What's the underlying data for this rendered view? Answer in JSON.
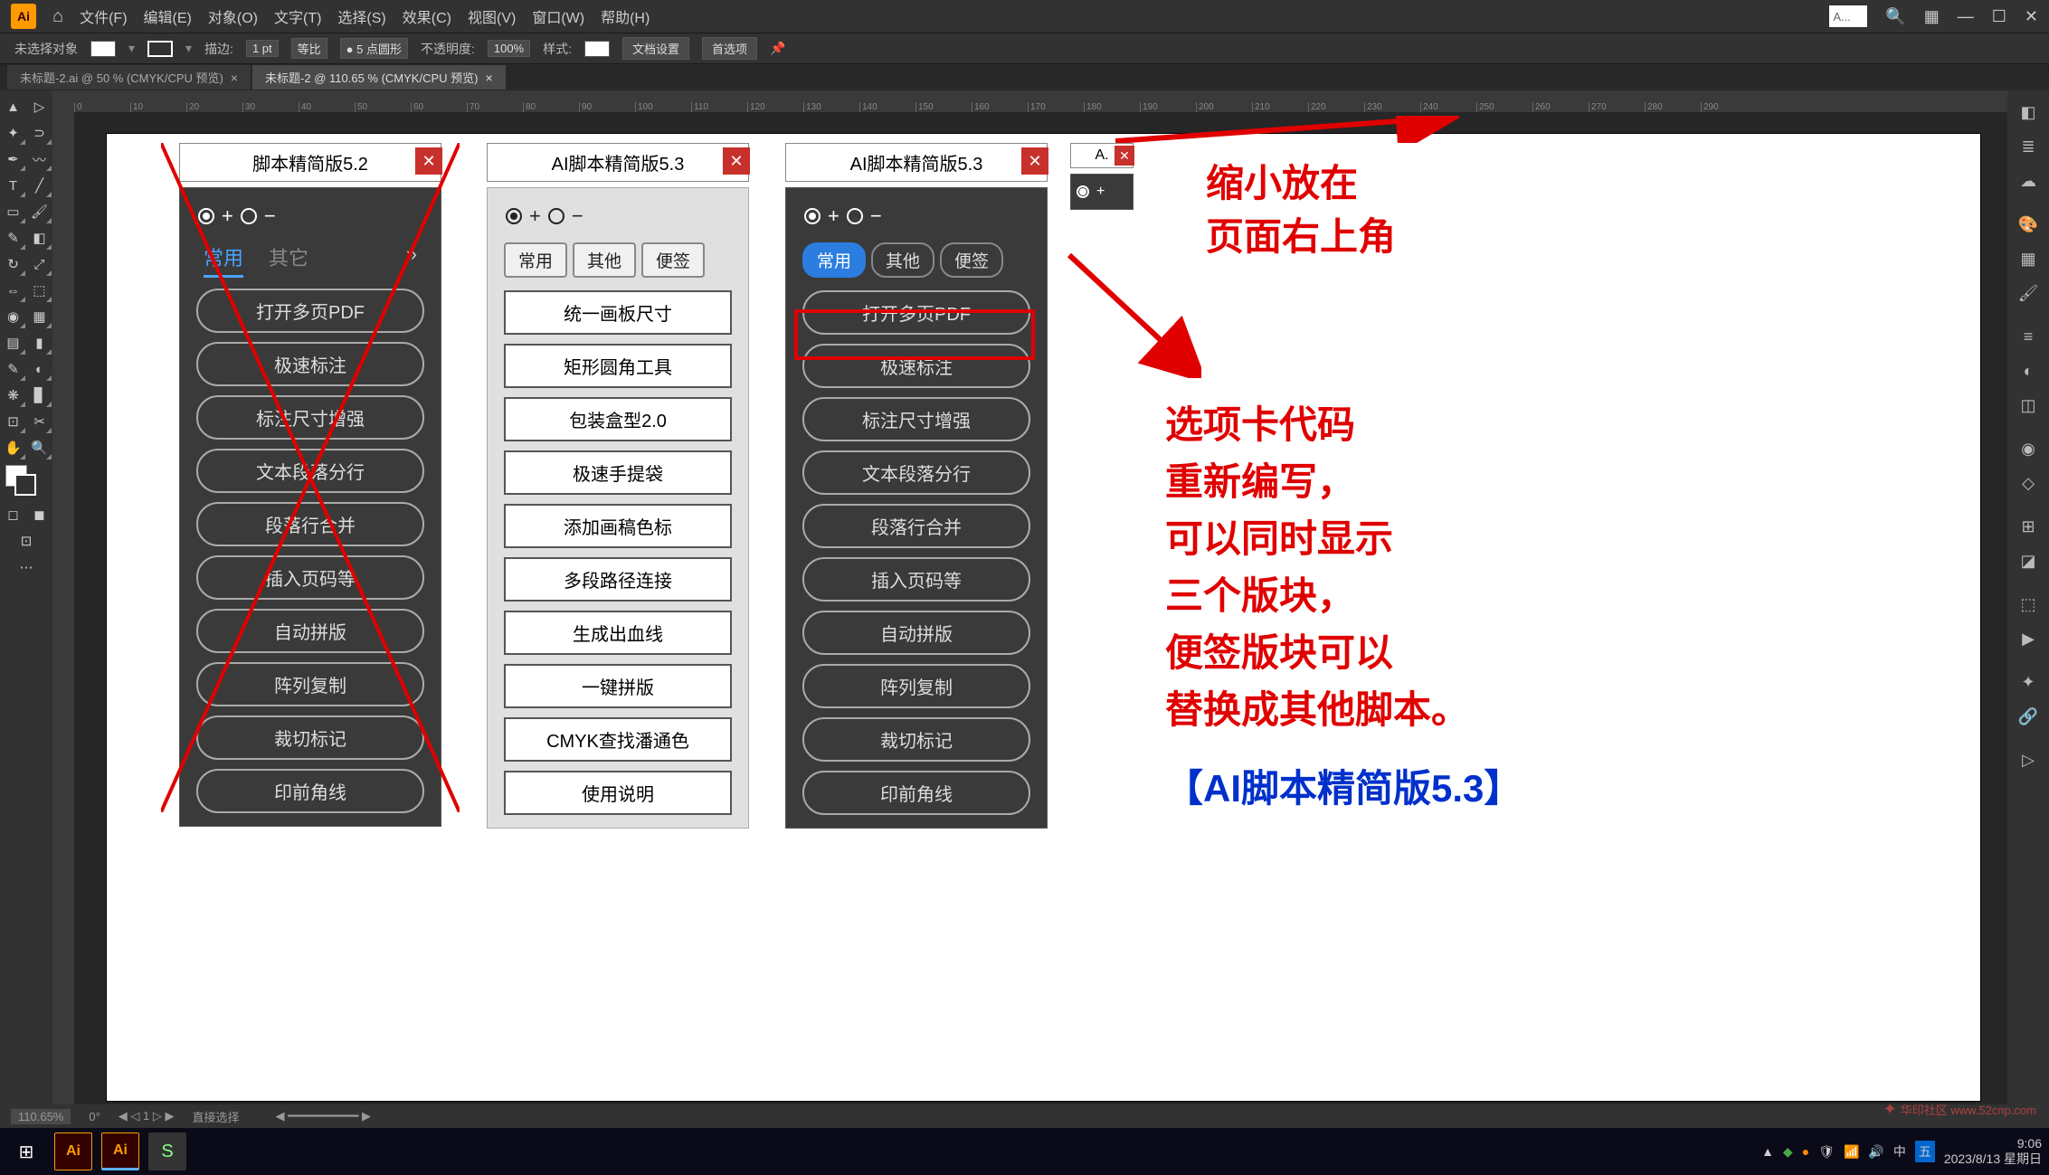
{
  "menubar": {
    "items": [
      "文件(F)",
      "编辑(E)",
      "对象(O)",
      "文字(T)",
      "选择(S)",
      "效果(C)",
      "视图(V)",
      "窗口(W)",
      "帮助(H)"
    ],
    "search_placeholder": "A..."
  },
  "optbar": {
    "noselect": "未选择对象",
    "stroke_label": "描边:",
    "stroke_val": "1 pt",
    "uniform": "等比",
    "brush": "5 点圆形",
    "opacity_label": "不透明度:",
    "opacity_val": "100%",
    "style_label": "样式:",
    "docsetup": "文档设置",
    "prefs": "首选项"
  },
  "doctabs": [
    {
      "label": "未标题-2.ai @ 50 % (CMYK/CPU 预览)"
    },
    {
      "label": "未标题-2 @ 110.65 % (CMYK/CPU 预览)"
    }
  ],
  "ruler_ticks": [
    0,
    10,
    20,
    30,
    40,
    50,
    60,
    70,
    80,
    90,
    100,
    110,
    120,
    130,
    140,
    150,
    160,
    170,
    180,
    190,
    200,
    210,
    220,
    230,
    240,
    250,
    260,
    270,
    280,
    290
  ],
  "panel52": {
    "title": "脚本精简版5.2",
    "tabs": [
      "常用",
      "其它"
    ],
    "buttons": [
      "打开多页PDF",
      "极速标注",
      "标注尺寸增强",
      "文本段落分行",
      "段落行合并",
      "插入页码等",
      "自动拼版",
      "阵列复制",
      "裁切标记",
      "印前角线"
    ]
  },
  "panel53light": {
    "title": "AI脚本精简版5.3",
    "tabs": [
      "常用",
      "其他",
      "便签"
    ],
    "buttons": [
      "统一画板尺寸",
      "矩形圆角工具",
      "包装盒型2.0",
      "极速手提袋",
      "添加画稿色标",
      "多段路径连接",
      "生成出血线",
      "一键拼版",
      "CMYK查找潘通色",
      "使用说明"
    ]
  },
  "panel53dark": {
    "title": "AI脚本精简版5.3",
    "tabs": [
      "常用",
      "其他",
      "便签"
    ],
    "buttons": [
      "打开多页PDF",
      "极速标注",
      "标注尺寸增强",
      "文本段落分行",
      "段落行合并",
      "插入页码等",
      "自动拼版",
      "阵列复制",
      "裁切标记",
      "印前角线"
    ]
  },
  "panelmini": {
    "title": "A."
  },
  "annotations": {
    "top": "缩小放在\n页面右上角",
    "mid": "选项卡代码\n重新编写，\n可以同时显示\n三个版块，\n便签版块可以\n替换成其他脚本。",
    "bottom": "【AI脚本精简版5.3】"
  },
  "status": {
    "zoom": "110.65%",
    "rotate": "0°",
    "artboard": "1",
    "tool": "直接选择"
  },
  "taskbar": {
    "time": "9:06",
    "date": "2023/8/13 星期日"
  },
  "watermark": "华印社区 www.52cnp.com"
}
